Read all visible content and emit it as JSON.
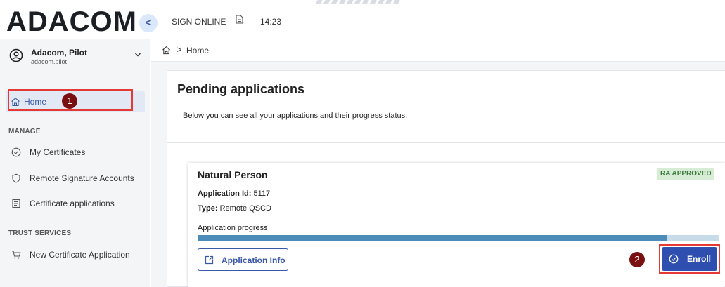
{
  "header": {
    "logo": "ADACOM",
    "collapse_glyph": "<",
    "status": "SIGN ONLINE",
    "status_icon": "document-icon",
    "time": "14:23"
  },
  "user": {
    "name": "Adacom, Pilot",
    "login": "adacom.pilot",
    "icon": "user-circle-icon",
    "chevron": "chevron-down-icon"
  },
  "sidebar": {
    "home": {
      "label": "Home",
      "icon": "home-icon"
    },
    "sections": [
      {
        "title": "MANAGE",
        "items": [
          {
            "label": "My Certificates",
            "icon": "check-circle-icon"
          },
          {
            "label": "Remote Signature Accounts",
            "icon": "shield-icon"
          },
          {
            "label": "Certificate applications",
            "icon": "document-list-icon"
          }
        ]
      },
      {
        "title": "TRUST SERVICES",
        "items": [
          {
            "label": "New Certificate Application",
            "icon": "cart-icon"
          }
        ]
      }
    ]
  },
  "breadcrumb": {
    "icon": "home-icon",
    "separator": ">",
    "current": "Home"
  },
  "main": {
    "title": "Pending applications",
    "subtitle": "Below you can see all your applications and their progress status.",
    "application": {
      "title": "Natural Person",
      "status": "RA APPROVED",
      "status_color": "#3b7a3a",
      "id_label": "Application Id:",
      "id_value": "5117",
      "type_label": "Type:",
      "type_value": "Remote QSCD",
      "progress_label": "Application progress",
      "progress": 0.9,
      "info_button": "Application Info",
      "enroll_button": "Enroll"
    }
  },
  "annotations": {
    "step1": "1",
    "step2": "2"
  },
  "colors": {
    "accent": "#2f4fb0",
    "highlight": "#e53935",
    "badge": "#7a0f12",
    "progress": "#4b8db8"
  }
}
